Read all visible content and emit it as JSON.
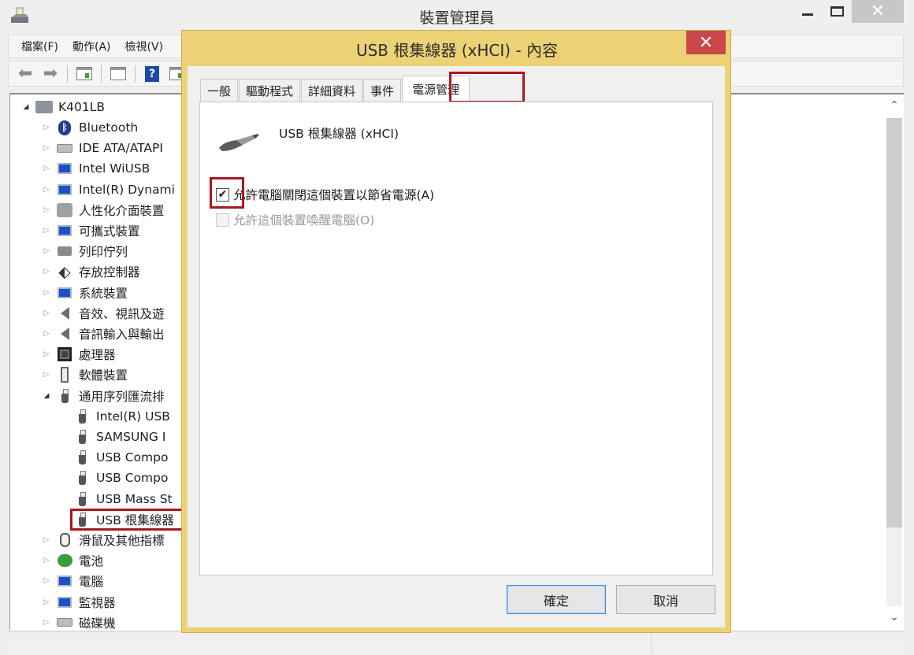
{
  "main_window": {
    "title": "裝置管理員",
    "menu": [
      "檔案(F)",
      "動作(A)",
      "檢視(V)"
    ],
    "toolbar": {
      "back_icon": "back-arrow-icon",
      "forward_icon": "forward-arrow-icon",
      "help_label": "?"
    },
    "window_controls": {
      "close_glyph": "✕"
    }
  },
  "tree": {
    "root": "K401LB",
    "items": [
      {
        "label": "Bluetooth",
        "icon": "bluetooth-icon"
      },
      {
        "label": "IDE ATA/ATAPI",
        "icon": "drive-icon"
      },
      {
        "label": "Intel WiUSB",
        "icon": "network-icon"
      },
      {
        "label": "Intel(R) Dynami",
        "icon": "monitor-icon"
      },
      {
        "label": "人性化介面裝置",
        "icon": "hid-icon"
      },
      {
        "label": "可攜式裝置",
        "icon": "portable-device-icon"
      },
      {
        "label": "列印佇列",
        "icon": "printer-icon"
      },
      {
        "label": "存放控制器",
        "icon": "storage-controller-icon"
      },
      {
        "label": "系統裝置",
        "icon": "system-device-icon"
      },
      {
        "label": "音效、視訊及遊",
        "icon": "speaker-icon"
      },
      {
        "label": "音訊輸入與輸出",
        "icon": "speaker-icon"
      },
      {
        "label": "處理器",
        "icon": "cpu-icon"
      },
      {
        "label": "軟體裝置",
        "icon": "software-device-icon"
      },
      {
        "label": "通用序列匯流排",
        "icon": "usb-icon",
        "expanded": true
      }
    ],
    "usb_children": [
      "Intel(R) USB",
      "SAMSUNG I",
      "USB Compo",
      "USB Compo",
      "USB Mass St",
      "USB 根集線器"
    ],
    "after_items": [
      {
        "label": "滑鼠及其他指標",
        "icon": "mouse-icon"
      },
      {
        "label": "電池",
        "icon": "battery-icon"
      },
      {
        "label": "電腦",
        "icon": "computer-icon"
      },
      {
        "label": "監視器",
        "icon": "monitor-icon"
      },
      {
        "label": "磁碟機",
        "icon": "disk-icon"
      }
    ],
    "selected": "USB 根集線器"
  },
  "dialog": {
    "title": "USB 根集線器 (xHCI) - 內容",
    "close_glyph": "✕",
    "tabs": [
      "一般",
      "驅動程式",
      "詳細資料",
      "事件",
      "電源管理"
    ],
    "active_tab": "電源管理",
    "device_name": "USB 根集線器 (xHCI)",
    "options": [
      {
        "label": "允許電腦關閉這個裝置以節省電源(A)",
        "checked": true,
        "enabled": true
      },
      {
        "label": "允許這個裝置喚醒電腦(O)",
        "checked": false,
        "enabled": false
      }
    ],
    "ok_label": "確定",
    "cancel_label": "取消"
  },
  "colors": {
    "highlight_box": "#a8191f",
    "dialog_frame": "#ecd275",
    "dialog_close": "#c9474a"
  }
}
